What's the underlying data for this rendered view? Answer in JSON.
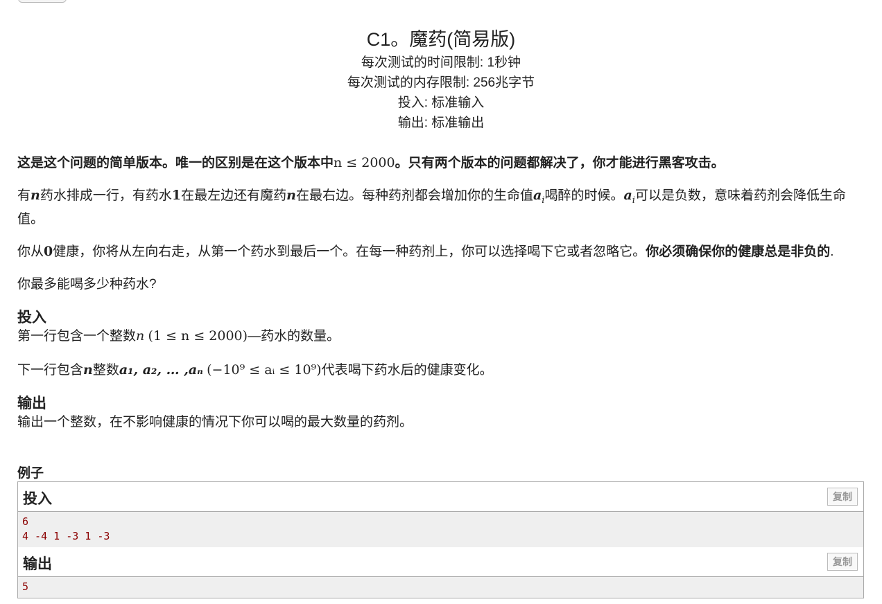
{
  "header": {
    "title": "C1。魔药(简易版)",
    "time_limit": "每次测试的时间限制: 1秒钟",
    "memory_limit": "每次测试的内存限制: 256兆字节",
    "input_file": "投入: 标准输入",
    "output_file": "输出: 标准输出"
  },
  "note": {
    "p1": "这是这个问题的简单版本。唯一的区别是在这个版本中",
    "math": "n ≤ 2000",
    "p2": "。只有两个版本的问题都解决了，你才能进行黑客攻击。"
  },
  "statement": {
    "a1": "有",
    "n1": "n",
    "a2": "药水排成一行，有药水",
    "one": "1",
    "a3": "在最左边还有魔药",
    "n2": "n",
    "a4": "在最右边。每种药剂都会增加你的生命值",
    "ai1": "a",
    "ai1sub": "i",
    "a5": "喝醉的时候。",
    "ai2": "a",
    "ai2sub": "i",
    "a6": "可以是负数，意味着药剂会降低生命值。",
    "b1": "你从",
    "zero": "0",
    "b2": "健康，你将从左向右走，从第一个药水到最后一个。在每一种药剂上，你可以选择喝下它或者忽略它。",
    "b3": "你必须确保你的健康总是非负的",
    "b4": ".",
    "c1": "你最多能喝多少种药水?"
  },
  "input_section": {
    "title": "投入",
    "l1a": "第一行包含一个整数",
    "l1n": "n",
    "l1math": "(1 ≤ n ≤ 2000)",
    "l1b": "—药水的数量。",
    "l2a": "下一行包含",
    "l2n": "n",
    "l2b": "整数",
    "l2seq": "a₁, a₂, … ,aₙ",
    "l2math": "(−10⁹ ≤ aᵢ ≤ 10⁹)",
    "l2c": "代表喝下药水后的健康变化。"
  },
  "output_section": {
    "title": "输出",
    "text": "输出一个整数，在不影响健康的情况下你可以喝的最大数量的药剂。"
  },
  "examples": {
    "title": "例子",
    "input_label": "投入",
    "output_label": "输出",
    "copy_label": "复制",
    "input_line1": "6",
    "input_line2": "4 -4 1 -3 1 -3",
    "output_line1": "5"
  }
}
